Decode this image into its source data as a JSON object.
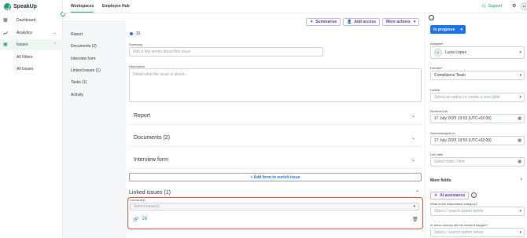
{
  "app": {
    "name": "SpeakUp"
  },
  "topbar": {
    "tabs": [
      {
        "label": "Workspaces"
      },
      {
        "label": "Employee Hub"
      }
    ],
    "support_label": "Support",
    "avatar_initials": "LL"
  },
  "sidebar": {
    "items": [
      {
        "label": "Dashboard"
      },
      {
        "label": "Analytics"
      },
      {
        "label": "Issues"
      }
    ],
    "sub_items": [
      {
        "label": "All Filters"
      },
      {
        "label": "All Issues"
      }
    ]
  },
  "content_nav": {
    "items": [
      {
        "label": "Report"
      },
      {
        "label": "Documents (2)"
      },
      {
        "label": "Interview form"
      },
      {
        "label": "Linked issues (1)"
      },
      {
        "label": "Tasks (1)"
      },
      {
        "label": "Activity"
      }
    ]
  },
  "actions": {
    "summarise": "Summarise",
    "add_user": "Add access",
    "more_actions": "More actions"
  },
  "issue": {
    "number": "31",
    "summary_label": "Summary",
    "summary_placeholder": "Add a few words about this issue",
    "description_label": "Description",
    "description_placeholder": "Detail what the issue is about...",
    "sections": {
      "report": "Report",
      "documents": "Documents (2)",
      "interview": "Interview form",
      "add_form": "+ Add form to enrich issue",
      "linked": "Linked issues (1)"
    },
    "link_label": "Link issue(s)",
    "link_placeholder": "Select issue(s)",
    "linked_item": "26"
  },
  "rightpanel": {
    "status": "In progress",
    "assignee_label": "Assignee",
    "assignee_initials": "LL",
    "assignee_name": "Lucia Lopez",
    "domain_label": "Domain*",
    "domain_value": "Compliance Team",
    "labels_label": "Labels",
    "labels_placeholder": "Select an option or create a new label",
    "received_label": "Received on",
    "received_value": "17 July 2025 13:53 (UTC+02:00)",
    "ack_label": "Acknowledged on",
    "ack_value": "17 July 2025 13:53 (UTC+02:00)",
    "due_label": "Due date",
    "due_placeholder": "Select date / time",
    "more_fields": "More fields",
    "ai_assistance": "AI assistance",
    "q1": "What is the misconduct category?",
    "q1_placeholder": "Select / search option below",
    "q2": "In which country did the incident happen?",
    "q2_placeholder": "Select / search option below"
  },
  "colors": {
    "accent": "#22a06b",
    "primary": "#1a73e8",
    "danger": "#e74c3c",
    "purple": "#5b3a9e"
  }
}
